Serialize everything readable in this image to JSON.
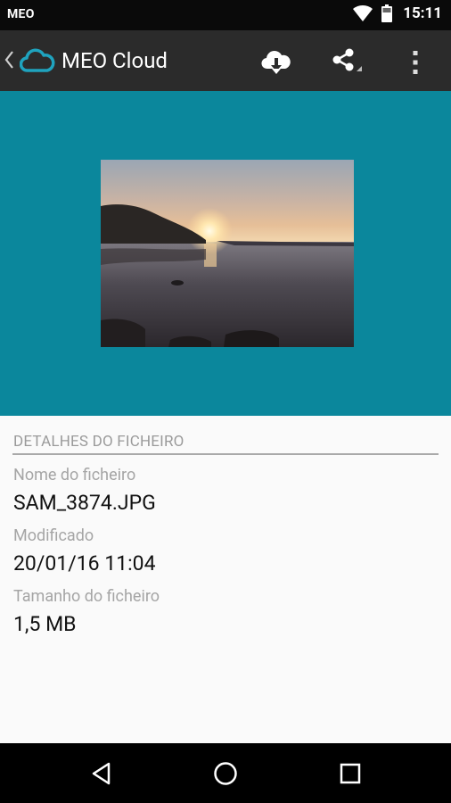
{
  "status_bar": {
    "carrier": "MEO",
    "time": "15:11",
    "icons": [
      "wifi-icon",
      "battery-icon"
    ]
  },
  "app_bar": {
    "title": "MEO Cloud",
    "icons": [
      "back-chevron-icon",
      "cloud-logo-icon",
      "cloud-download-icon",
      "share-icon",
      "overflow-menu-icon"
    ]
  },
  "details": {
    "section_title": "DETALHES DO FICHEIRO",
    "fields": [
      {
        "label": "Nome do ficheiro",
        "value": "SAM_3874.JPG"
      },
      {
        "label": "Modificado",
        "value": "20/01/16 11:04"
      },
      {
        "label": "Tamanho do ficheiro",
        "value": "1,5 MB"
      }
    ]
  },
  "nav_bar": {
    "icons": [
      "back-triangle-icon",
      "home-circle-icon",
      "recents-square-icon"
    ]
  },
  "colors": {
    "hero_background": "#0b879c",
    "app_bar": "#2b2b2b",
    "accent": "#1fa3be"
  }
}
